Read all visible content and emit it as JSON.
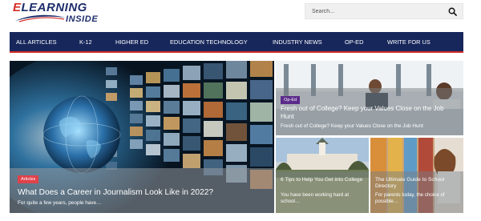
{
  "logo": {
    "line1_e": "E",
    "line1_rest": "LEARNING",
    "line2": "INSIDE",
    "brand_red": "#d52d27",
    "brand_navy": "#1d2e6b"
  },
  "search": {
    "placeholder": "Search...",
    "button_icon": "search-icon"
  },
  "nav": {
    "bg_color": "#17275c",
    "items": [
      "ALL ARTICLES",
      "K-12",
      "HIGHER ED",
      "EDUCATION TECHNOLOGY",
      "INDUSTRY NEWS",
      "OP-ED",
      "WRITE FOR US"
    ]
  },
  "hero": {
    "tag": "Articles",
    "title": "What Does a Career in Journalism Look Like in 2022?",
    "excerpt": "For quite a few years, people have…"
  },
  "cards": [
    {
      "tag": "Op-Ed",
      "title": "Fresh out of College? Keep your Values Close on the Job Hunt",
      "excerpt": "Fresh out of College? Keep your Values Close on the Job Hunt"
    },
    {
      "title": "6 Tips to Help You Get into College",
      "excerpt": "You have been working hard at school…"
    },
    {
      "title": "The Ultimate Guide to School Directory",
      "excerpt": "For parents today, the choice of possible…"
    }
  ]
}
